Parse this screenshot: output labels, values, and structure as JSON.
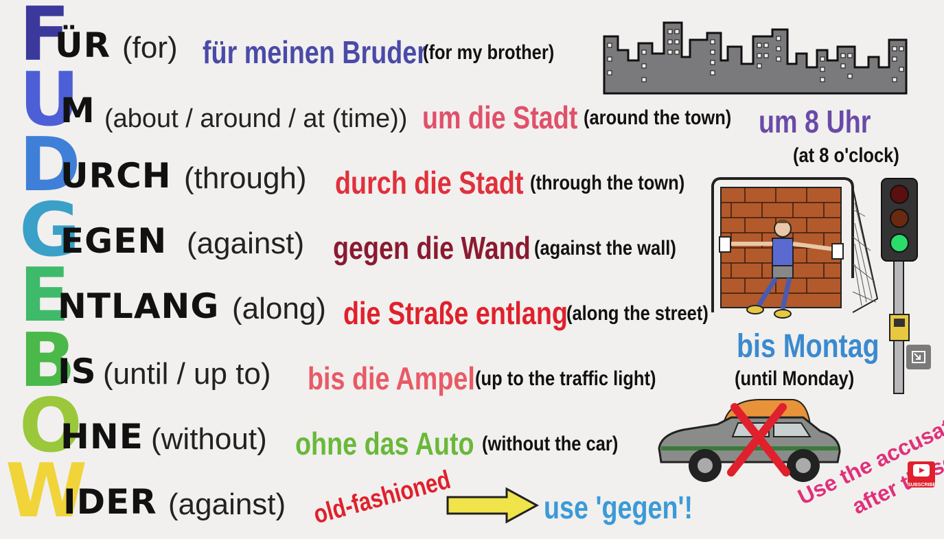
{
  "rows": [
    {
      "first": "F",
      "rest": "ÜR",
      "en": "(for)",
      "de": "für meinen Bruder",
      "tr": "(for my brother)",
      "color": "#3b3a9c",
      "deColor": "#4a4aa8"
    },
    {
      "first": "U",
      "rest": "M",
      "en": "(about / around / at (time))",
      "de": "um die Stadt",
      "tr": "(around the town)",
      "de2": "um 8 Uhr",
      "tr2": "(at 8 o'clock)",
      "color": "#4d5fd6",
      "deColor": "#e0506a",
      "de2Color": "#6a4aa8"
    },
    {
      "first": "D",
      "rest": "URCH",
      "en": "(through)",
      "de": "durch die Stadt",
      "tr": "(through the town)",
      "color": "#3f7fd8",
      "deColor": "#e0303c"
    },
    {
      "first": "G",
      "rest": "EGEN",
      "en": "(against)",
      "de": "gegen die Wand",
      "tr": "(against the wall)",
      "color": "#3aa0c8",
      "deColor": "#8a1a30"
    },
    {
      "first": "E",
      "rest": "NTLANG",
      "en": "(along)",
      "de": "die Straße entlang",
      "tr": "(along the street)",
      "color": "#3fba6a",
      "deColor": "#e0202c"
    },
    {
      "first": "B",
      "rest": "IS",
      "en": "(until / up to)",
      "de": "bis die Ampel",
      "tr": "(up to the traffic light)",
      "color": "#4bb84a",
      "deColor": "#e85a66"
    },
    {
      "first": "O",
      "rest": "HNE",
      "en": "(without)",
      "de": "ohne das Auto",
      "tr": "(without the car)",
      "color": "#9ac83a",
      "deColor": "#6ab83a"
    },
    {
      "first": "W",
      "rest": "IDER",
      "en": "(against)",
      "color": "#f0d43a"
    }
  ],
  "bis_montag": {
    "de": "bis Montag",
    "tr": "(until Monday)",
    "color": "#3a8ad0"
  },
  "old_fashioned": {
    "text": "old-fashioned",
    "color": "#e0202c"
  },
  "use_gegen": {
    "text": "use 'gegen'!",
    "color": "#3a9ad8"
  },
  "accusative_note": {
    "line1": "Use the accusative",
    "line2": "after these",
    "color": "#e0307a"
  },
  "subscribe_label": "SUBSCRIBE",
  "icons": {
    "city": "city-skyline-icon",
    "goal": "goal-wall-icon",
    "traffic_light": "traffic-light-icon",
    "car": "taxi-car-icon",
    "arrow": "arrow-right-icon"
  }
}
